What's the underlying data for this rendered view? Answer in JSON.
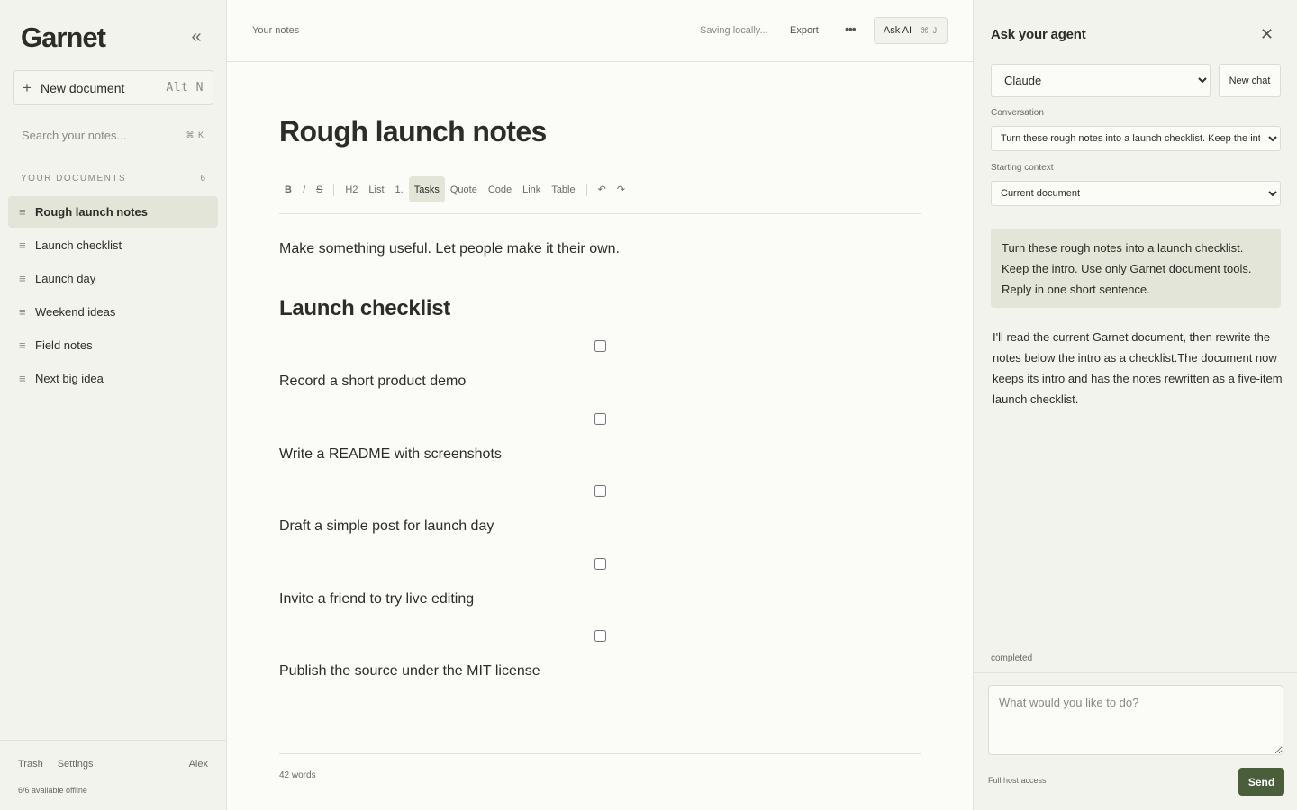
{
  "colors": {
    "accent": "#4b5e3c",
    "active_bg": "#e2e5d8",
    "sidebar_bg": "#f3f3ee",
    "page_bg": "#fbfbf8"
  },
  "sidebar": {
    "brand": "Garnet",
    "collapse_icon": "double-chevron-left-icon",
    "new_document": {
      "label": "New document",
      "shortcut": "Alt N"
    },
    "search": {
      "placeholder": "Search your notes...",
      "shortcut": "⌘ K"
    },
    "section_title": "YOUR DOCUMENTS",
    "section_count": "6",
    "documents": [
      {
        "label": "Rough launch notes",
        "active": true
      },
      {
        "label": "Launch checklist",
        "active": false
      },
      {
        "label": "Launch day",
        "active": false
      },
      {
        "label": "Weekend ideas",
        "active": false
      },
      {
        "label": "Field notes",
        "active": false
      },
      {
        "label": "Next big idea",
        "active": false
      }
    ],
    "footer": {
      "trash": "Trash",
      "settings": "Settings",
      "user": "Alex",
      "offline": "6/6 available offline"
    }
  },
  "topbar": {
    "breadcrumb": "Your notes",
    "saving": "Saving locally...",
    "export": "Export",
    "more": "•••",
    "ask_ai": {
      "label": "Ask AI",
      "shortcut": "⌘ J"
    }
  },
  "editor": {
    "title": "Rough launch notes",
    "toolbar": {
      "bold": "B",
      "italic": "I",
      "strike": "S",
      "h2": "H2",
      "list": "List",
      "ordered": "1.",
      "tasks": "Tasks",
      "quote": "Quote",
      "code": "Code",
      "link": "Link",
      "table": "Table",
      "undo": "↶",
      "redo": "↷",
      "active_tool": "Tasks"
    },
    "intro": "Make something useful. Let people make it their own.",
    "heading": "Launch checklist",
    "tasks": [
      {
        "text": "Record a short product demo",
        "checked": false
      },
      {
        "text": "Write a README with screenshots",
        "checked": false
      },
      {
        "text": "Draft a simple post for launch day",
        "checked": false
      },
      {
        "text": "Invite a friend to try live editing",
        "checked": false
      },
      {
        "text": "Publish the source under the MIT license",
        "checked": false
      }
    ],
    "word_count": "42 words"
  },
  "agent": {
    "title": "Ask your agent",
    "close_icon": "close-icon",
    "model": "Claude",
    "new_chat": "New chat",
    "conversation_label": "Conversation",
    "conversation_value": "Turn these rough notes into a launch checklist. Keep the intro.",
    "context_label": "Starting context",
    "context_value": "Current document",
    "user_message": "Turn these rough notes into a launch checklist. Keep the intro. Use only Garnet document tools. Reply in one short sentence.",
    "agent_message": "I'll read the current Garnet document, then rewrite the notes below the intro as a checklist.The document now keeps its intro and has the notes rewritten as a five-item launch checklist.",
    "status": "completed",
    "composer_placeholder": "What would you like to do?",
    "host_access": "Full host access",
    "send": "Send"
  }
}
